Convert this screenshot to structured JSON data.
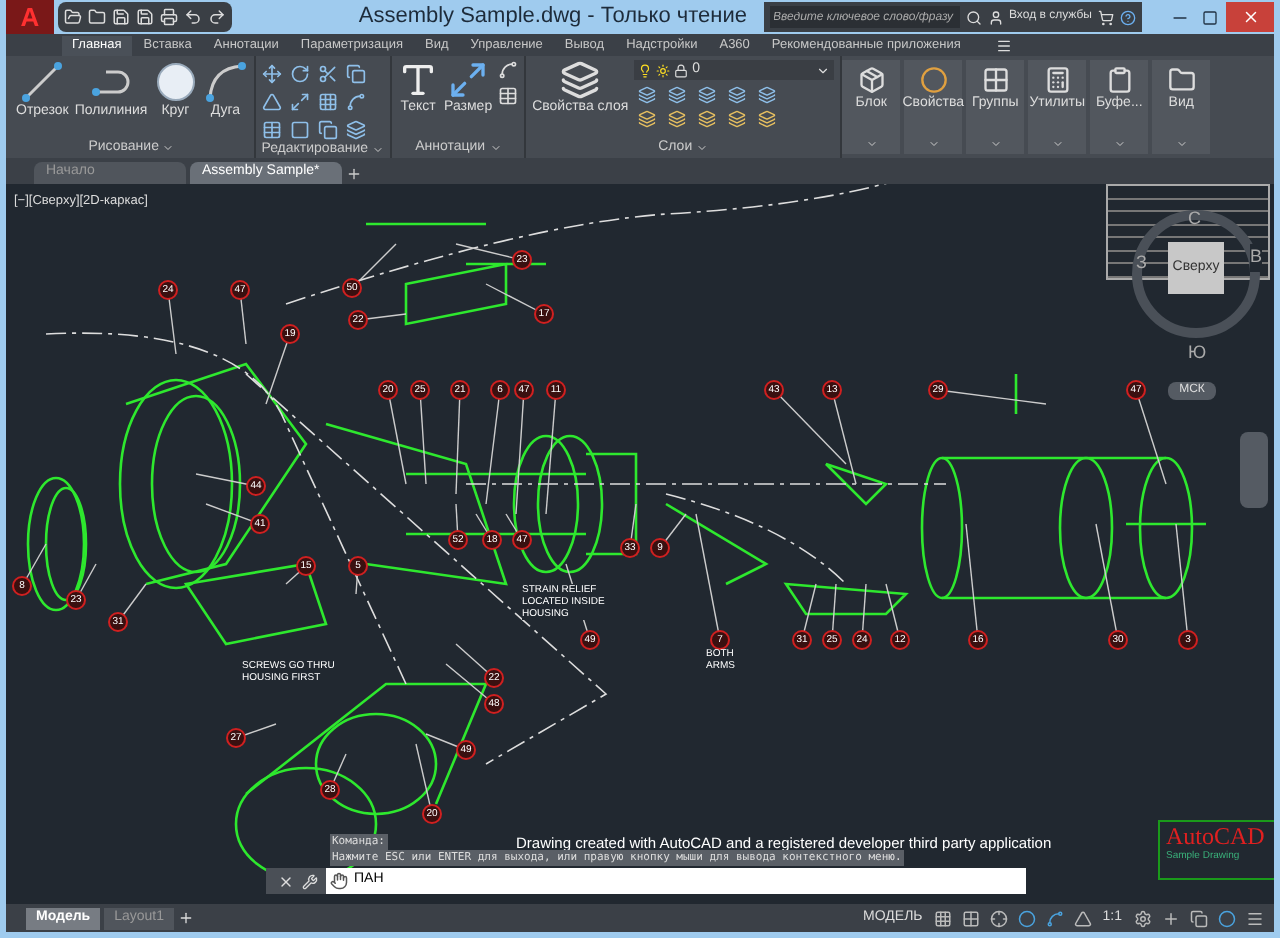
{
  "window": {
    "title": "Assembly Sample.dwg - Только чтение",
    "app_button": "A"
  },
  "search": {
    "placeholder": "Введите ключевое слово/фразу"
  },
  "sign_in": "Вход в службы",
  "ribbon_tabs": [
    {
      "label": "Главная",
      "selected": true
    },
    {
      "label": "Вставка",
      "selected": false
    },
    {
      "label": "Аннотации",
      "selected": false
    },
    {
      "label": "Параметризация",
      "selected": false
    },
    {
      "label": "Вид",
      "selected": false
    },
    {
      "label": "Управление",
      "selected": false
    },
    {
      "label": "Вывод",
      "selected": false
    },
    {
      "label": "Надстройки",
      "selected": false
    },
    {
      "label": "A360",
      "selected": false
    },
    {
      "label": "Рекомендованные приложения",
      "selected": false
    }
  ],
  "panels": [
    {
      "kind": "draw",
      "title": "Рисование",
      "tools": [
        "Отрезок",
        "Полилиния",
        "Круг",
        "Дуга"
      ]
    },
    {
      "kind": "modify",
      "title": "Редактирование"
    },
    {
      "kind": "annotate",
      "title": "Аннотации",
      "tools": [
        "Текст",
        "Размер"
      ]
    },
    {
      "kind": "layers",
      "title": "Слои",
      "tools": [
        "Свойства слоя"
      ],
      "layer": "0"
    }
  ],
  "big_buttons": [
    "Блок",
    "Свойства",
    "Группы",
    "Утилиты",
    "Буфе...",
    "Вид"
  ],
  "file_tabs": [
    {
      "label": "Начало",
      "selected": false
    },
    {
      "label": "Assembly Sample*",
      "selected": true
    }
  ],
  "viewport_label": "[−][Сверху][2D-каркас]",
  "viewcube": {
    "north": "С",
    "west": "З",
    "east": "В",
    "south": "Ю",
    "face": "Сверху",
    "ucs": "МСК"
  },
  "balloons": [
    "23",
    "24",
    "47",
    "50",
    "22",
    "17",
    "19",
    "20",
    "25",
    "21",
    "6",
    "47",
    "11",
    "43",
    "13",
    "29",
    "47",
    "44",
    "41",
    "52",
    "18",
    "47",
    "33",
    "9",
    "15",
    "5",
    "8",
    "23",
    "31",
    "49",
    "7",
    "31",
    "25",
    "24",
    "12",
    "16",
    "30",
    "3",
    "22",
    "48",
    "27",
    "49",
    "28",
    "20"
  ],
  "notes": [
    "STRAIN RELIEF LOCATED INSIDE HOUSING",
    "SCREWS GO THRU HOUSING FIRST",
    "BOTH ARMS"
  ],
  "credit": "Drawing created with AutoCAD and a registered developer third party application",
  "logo": {
    "title": "AutoCAD",
    "subtitle": "Sample Drawing"
  },
  "command": {
    "history": [
      "Команда:",
      "Нажмите ESC или ENTER для выхода, или правую кнопку мыши для вывода контекстного меню."
    ],
    "value": "ПАН"
  },
  "layout_tabs": [
    {
      "label": "Модель",
      "selected": true
    },
    {
      "label": "Layout1",
      "selected": false
    }
  ],
  "status": {
    "mode": "МОДЕЛЬ",
    "scale": "1:1"
  }
}
